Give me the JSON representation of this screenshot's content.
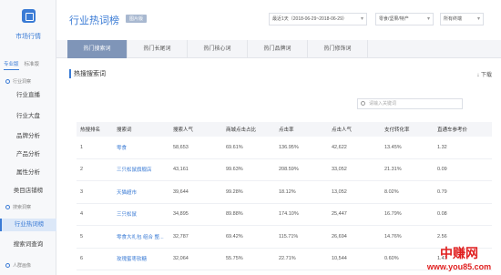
{
  "sidebar": {
    "app_name": "市场行情",
    "tabs": [
      "专业版",
      "标准版"
    ],
    "groups": [
      "行业洞察",
      "搜索洞察"
    ],
    "items": [
      "行业直播",
      "行业大盘",
      "品牌分析",
      "产品分析",
      "属性分析",
      "类目店铺榜"
    ],
    "search_items": [
      "行业热词榜",
      "搜索词查询"
    ],
    "bottom_group": "人群画像"
  },
  "header": {
    "title": "行业热词榜",
    "badge": "图片版",
    "date_range": "最近1天（2018-06-29~2018-06-29）",
    "category": "零食/坚果/特产",
    "terminal": "所有终端"
  },
  "tabs": [
    "热门搜索词",
    "热门长尾词",
    "热门核心词",
    "热门品牌词",
    "热门修饰词"
  ],
  "section": {
    "title": "热搜搜索词",
    "download": "下载",
    "search_placeholder": "请输入关键词"
  },
  "table": {
    "headers": [
      "热搜排名",
      "搜索词",
      "搜索人气",
      "商城点击占比",
      "点击率",
      "点击人气",
      "支付转化率",
      "直通车参考价"
    ],
    "rows": [
      [
        "1",
        "零食",
        "58,653",
        "69.61%",
        "136.95%",
        "42,622",
        "13.45%",
        "1.32"
      ],
      [
        "2",
        "三只松鼠旗舰店",
        "43,161",
        "99.63%",
        "208.59%",
        "33,052",
        "21.31%",
        "0.09"
      ],
      [
        "3",
        "天猫超市",
        "39,644",
        "99.28%",
        "18.12%",
        "13,052",
        "8.02%",
        "0.79"
      ],
      [
        "4",
        "三只松鼠",
        "34,895",
        "89.88%",
        "174.10%",
        "25,447",
        "16.79%",
        "0.08"
      ],
      [
        "5",
        "零食大礼包 组合 整...",
        "32,787",
        "69.42%",
        "115.71%",
        "26,694",
        "14.76%",
        "2.56"
      ],
      [
        "6",
        "玫瑰蜜枣软糖",
        "32,064",
        "55.75%",
        "22.71%",
        "10,544",
        "0.60%",
        "1.47"
      ]
    ]
  },
  "watermark": {
    "cn": "中赚网",
    "url": "www.you85.com"
  },
  "colors": {
    "accent": "#3a7bd5",
    "active_tab": "#7f95b8",
    "watermark": "#e02020"
  }
}
